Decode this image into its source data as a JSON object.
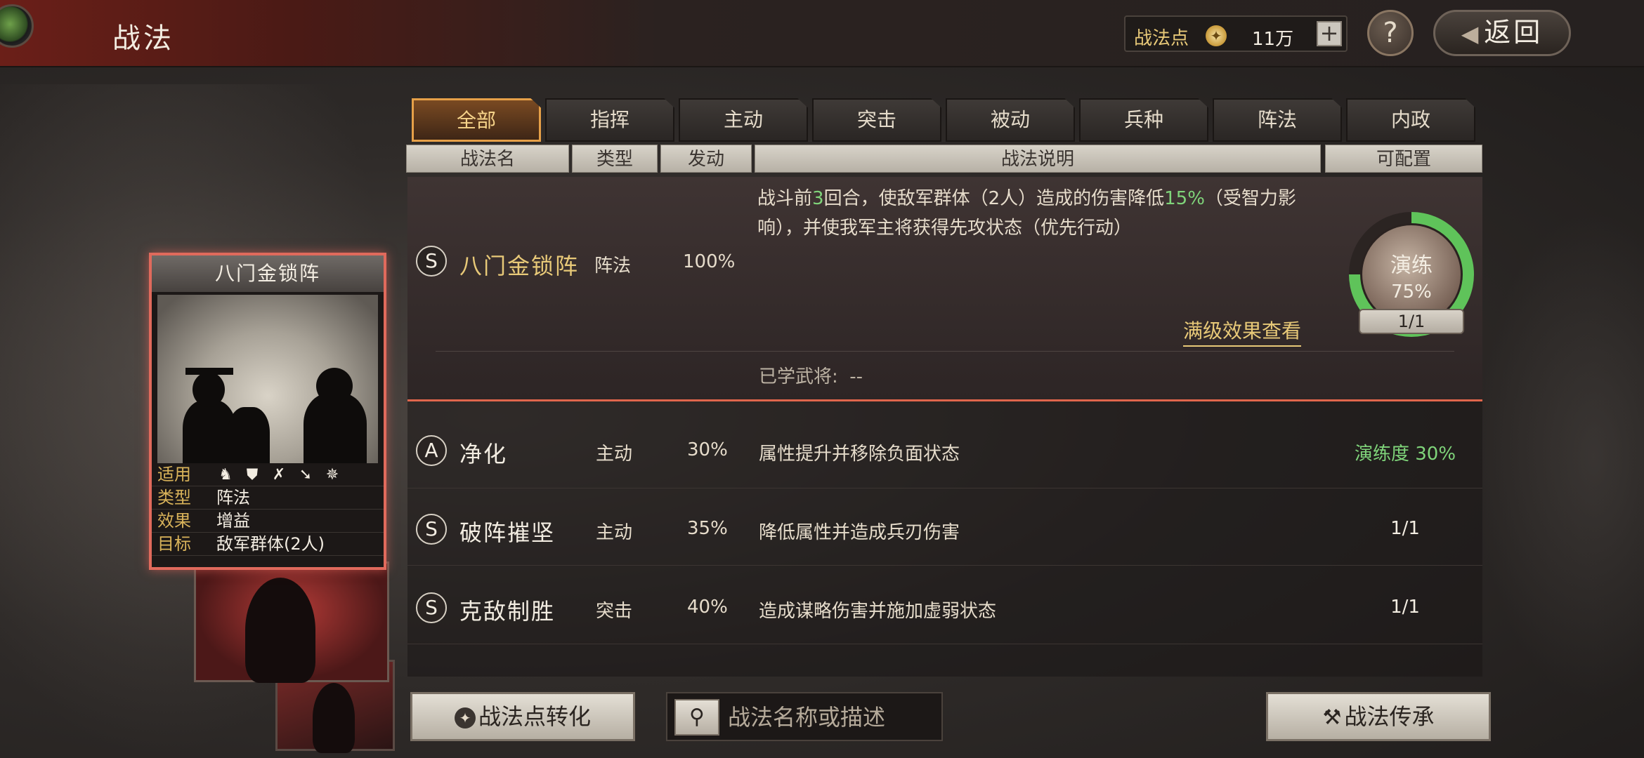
{
  "header": {
    "title": "战法",
    "points_label": "战法点",
    "points_value": "11万",
    "plus": "+",
    "help": "?",
    "back": "返回"
  },
  "tabs": [
    "全部",
    "指挥",
    "主动",
    "突击",
    "被动",
    "兵种",
    "阵法",
    "内政"
  ],
  "columns": {
    "name": "战法名",
    "type": "类型",
    "trigger": "发动",
    "desc": "战法说明",
    "config": "可配置"
  },
  "card": {
    "title": "八门金锁阵",
    "props": {
      "apply_label": "适用",
      "type_label": "类型",
      "type_value": "阵法",
      "effect_label": "效果",
      "effect_value": "增益",
      "target_label": "目标",
      "target_value": "敌军群体(2人)"
    },
    "apply_icons": [
      "cavalry-icon",
      "shield-icon",
      "bow-icon",
      "spear-icon",
      "wheel-icon"
    ]
  },
  "selected": {
    "grade": "S",
    "name": "八门金锁阵",
    "type": "阵法",
    "rate": "100%",
    "desc_1": "战斗前",
    "desc_num": "3",
    "desc_2": "回合，使敌军群体（2人）造成的伤害降低",
    "desc_pct": "15%",
    "desc_3": "（受智力影响），并使我军主将获得先攻状态（优先行动）",
    "max_link": "满级效果查看",
    "learned_label": "已学武将:",
    "learned_value": "--",
    "practice_label": "演练",
    "practice_value": "75%",
    "practice_fraction": 0.75,
    "count": "1/1"
  },
  "rows": [
    {
      "grade": "A",
      "name": "净化",
      "type": "主动",
      "rate": "30%",
      "desc": "属性提升并移除负面状态",
      "status": "演练度 30%"
    },
    {
      "grade": "S",
      "name": "破阵摧坚",
      "type": "主动",
      "rate": "35%",
      "desc": "降低属性并造成兵刃伤害",
      "status": "1/1"
    },
    {
      "grade": "S",
      "name": "克敌制胜",
      "type": "突击",
      "rate": "40%",
      "desc": "造成谋略伤害并施加虚弱状态",
      "status": "1/1"
    }
  ],
  "bottom": {
    "convert": "战法点转化",
    "search_placeholder": "战法名称或描述",
    "inherit": "战法传承"
  },
  "colors": {
    "accent_gold": "#e8c978",
    "active_tab_border": "#e6a048",
    "practice_green": "#5fc35a",
    "selected_border": "#e0664c"
  }
}
